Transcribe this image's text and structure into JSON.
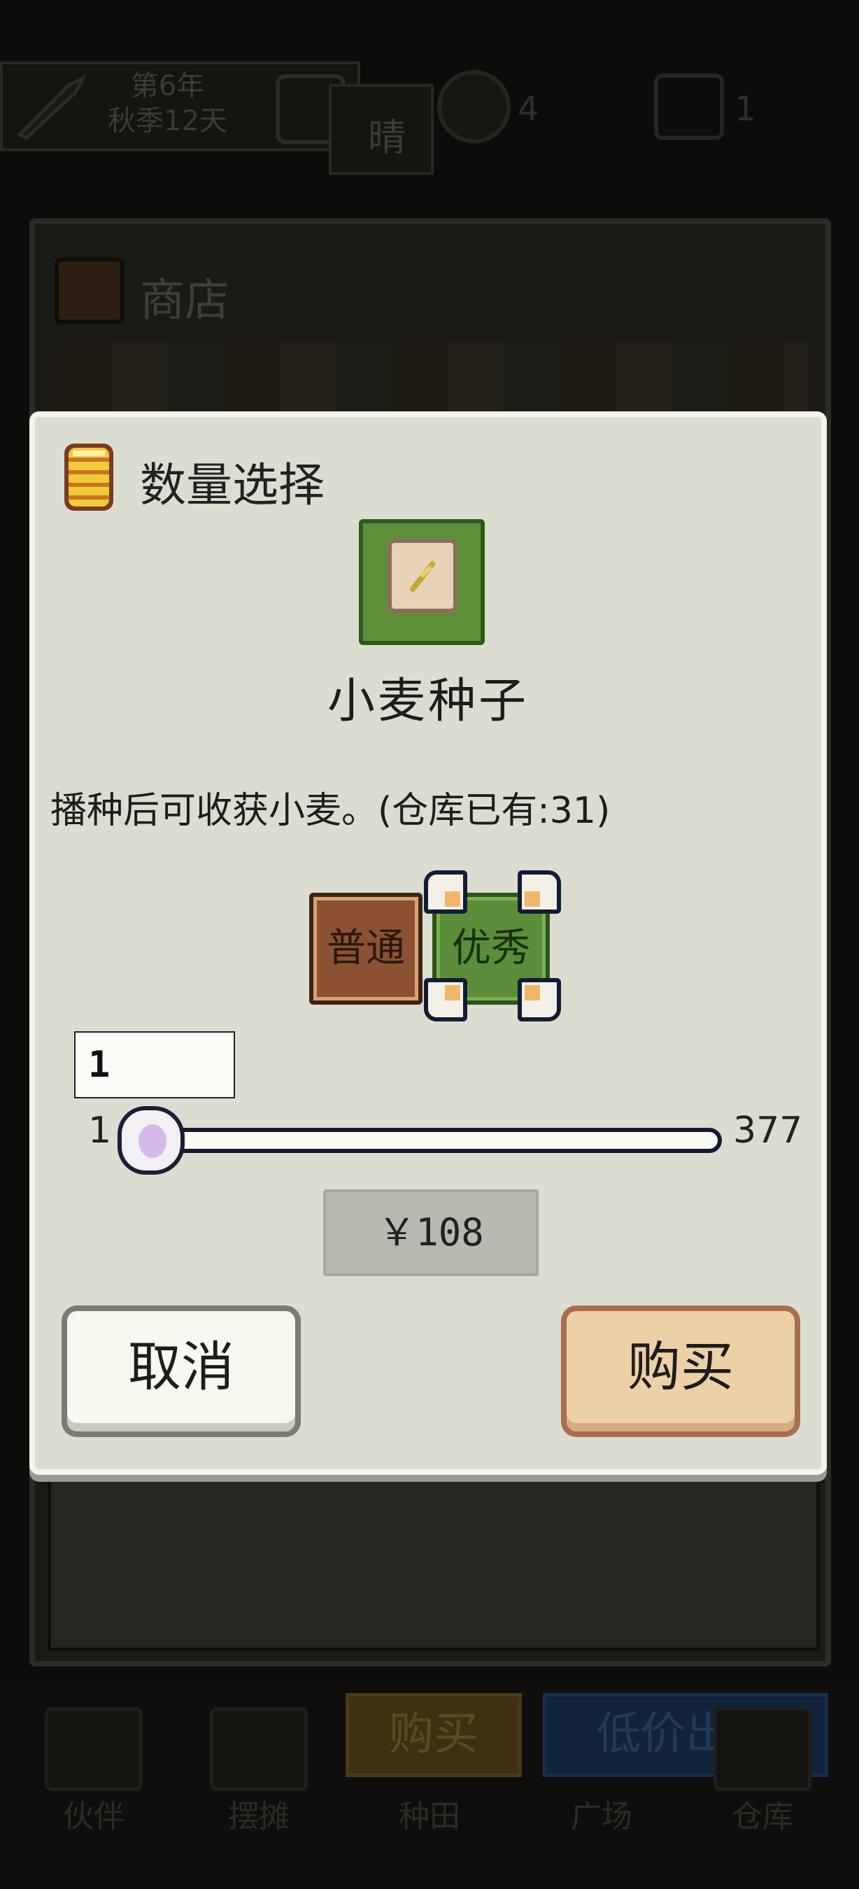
{
  "hud": {
    "date_line1": "第6年",
    "date_line2": "秋季12天",
    "weather": "晴",
    "money": "4",
    "gems": "1",
    "icons": [
      "feather-icon",
      "clock-icon",
      "coin-icon",
      "gem-icon"
    ]
  },
  "shop": {
    "title": "商店"
  },
  "background_actions": {
    "buy_label": "购买",
    "sell_label": "低价出售"
  },
  "nav": {
    "tabs": [
      "伙伴",
      "摆摊",
      "种田",
      "广场",
      "仓库"
    ]
  },
  "dialog": {
    "title": "数量选择",
    "item": {
      "name": "小麦种子",
      "description": "播种后可收获小麦。(仓库已有:31)",
      "icon": "seed-bag-icon"
    },
    "quality": {
      "options": [
        "普通",
        "优秀"
      ],
      "selected": "优秀"
    },
    "quantity": {
      "value": "1",
      "min": "1",
      "max": "377"
    },
    "price": "￥108",
    "cancel_label": "取消",
    "buy_label": "购买"
  },
  "colors": {
    "dialog_bg": "#dcddd1",
    "normal_quality": "#8a5233",
    "excellent_quality": "#5b8d3a",
    "buy_button": "#ecd1a6",
    "selection_border": "#121c33"
  }
}
